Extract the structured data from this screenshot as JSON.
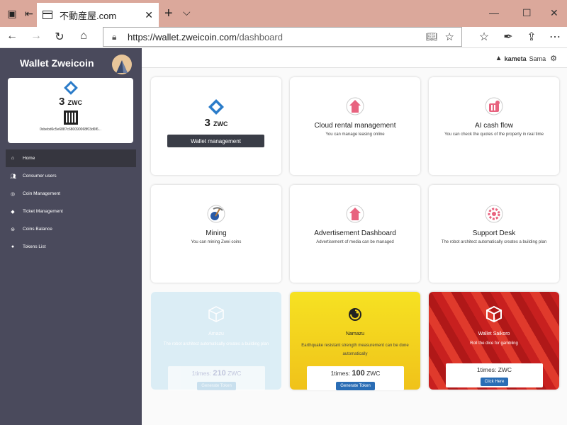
{
  "browser": {
    "tab_title": "不動産屋.com",
    "url_main": "https://wallet.zweicoin.com",
    "url_path": "/dashboard"
  },
  "sidebar": {
    "brand": "Wallet Zweicoin",
    "wallet": {
      "amount": "3",
      "unit": "ZWC",
      "address": "0xbebd6c5e6887c680090068f03d6f6..."
    },
    "items": [
      {
        "label": "Home",
        "icon": "home-icon"
      },
      {
        "label": "Consumer users",
        "icon": "users-icon"
      },
      {
        "label": "Coin Management",
        "icon": "coin-icon"
      },
      {
        "label": "Ticket Management",
        "icon": "ticket-icon"
      },
      {
        "label": "Coins Balance",
        "icon": "balance-icon"
      },
      {
        "label": "Tokens List",
        "icon": "dot-icon"
      }
    ]
  },
  "header": {
    "user_name": "kameta",
    "user_suffix": "Sama"
  },
  "cards": {
    "wallet": {
      "amount": "3",
      "unit": "ZWC",
      "button": "Wallet management"
    },
    "cloud": {
      "title": "Cloud rental management",
      "subtitle": "You can manage leasing online"
    },
    "ai": {
      "title": "AI cash flow",
      "subtitle": "You can check the quotes of the property in real time"
    },
    "mining": {
      "title": "Mining",
      "subtitle": "You can mining Zwei coins"
    },
    "ads": {
      "title": "Advertisement Dashboard",
      "subtitle": "Advertisement of media can be managed"
    },
    "support": {
      "title": "Support Desk",
      "subtitle": "The robot architect automatically creates a building plan"
    },
    "amazu": {
      "title": "Amazu",
      "subtitle": "The robot architect automatically creates a building plan",
      "times_label": "1times:",
      "times_value": "210",
      "unit": "ZWC",
      "button": "Generate Token"
    },
    "namazu": {
      "title": "Namazu",
      "subtitle": "Earthquake resistant strength measurement can be done automatically",
      "times_label": "1times:",
      "times_value": "100",
      "unit": "ZWC",
      "button": "Generate Token"
    },
    "sakoro": {
      "title": "Wallet Saikoro",
      "subtitle": "Roll the dice for gambling",
      "times_label": "1times:",
      "unit": "ZWC",
      "button": "Click Here"
    }
  },
  "colors": {
    "sidebar": "#4a4a5c",
    "tabbar": "#dba89b",
    "accent_blue": "#2a6db5",
    "namazu_yellow": "#f2d21c",
    "sakoro_red": "#c8201f",
    "amazu_blue": "#cfe6f2"
  }
}
